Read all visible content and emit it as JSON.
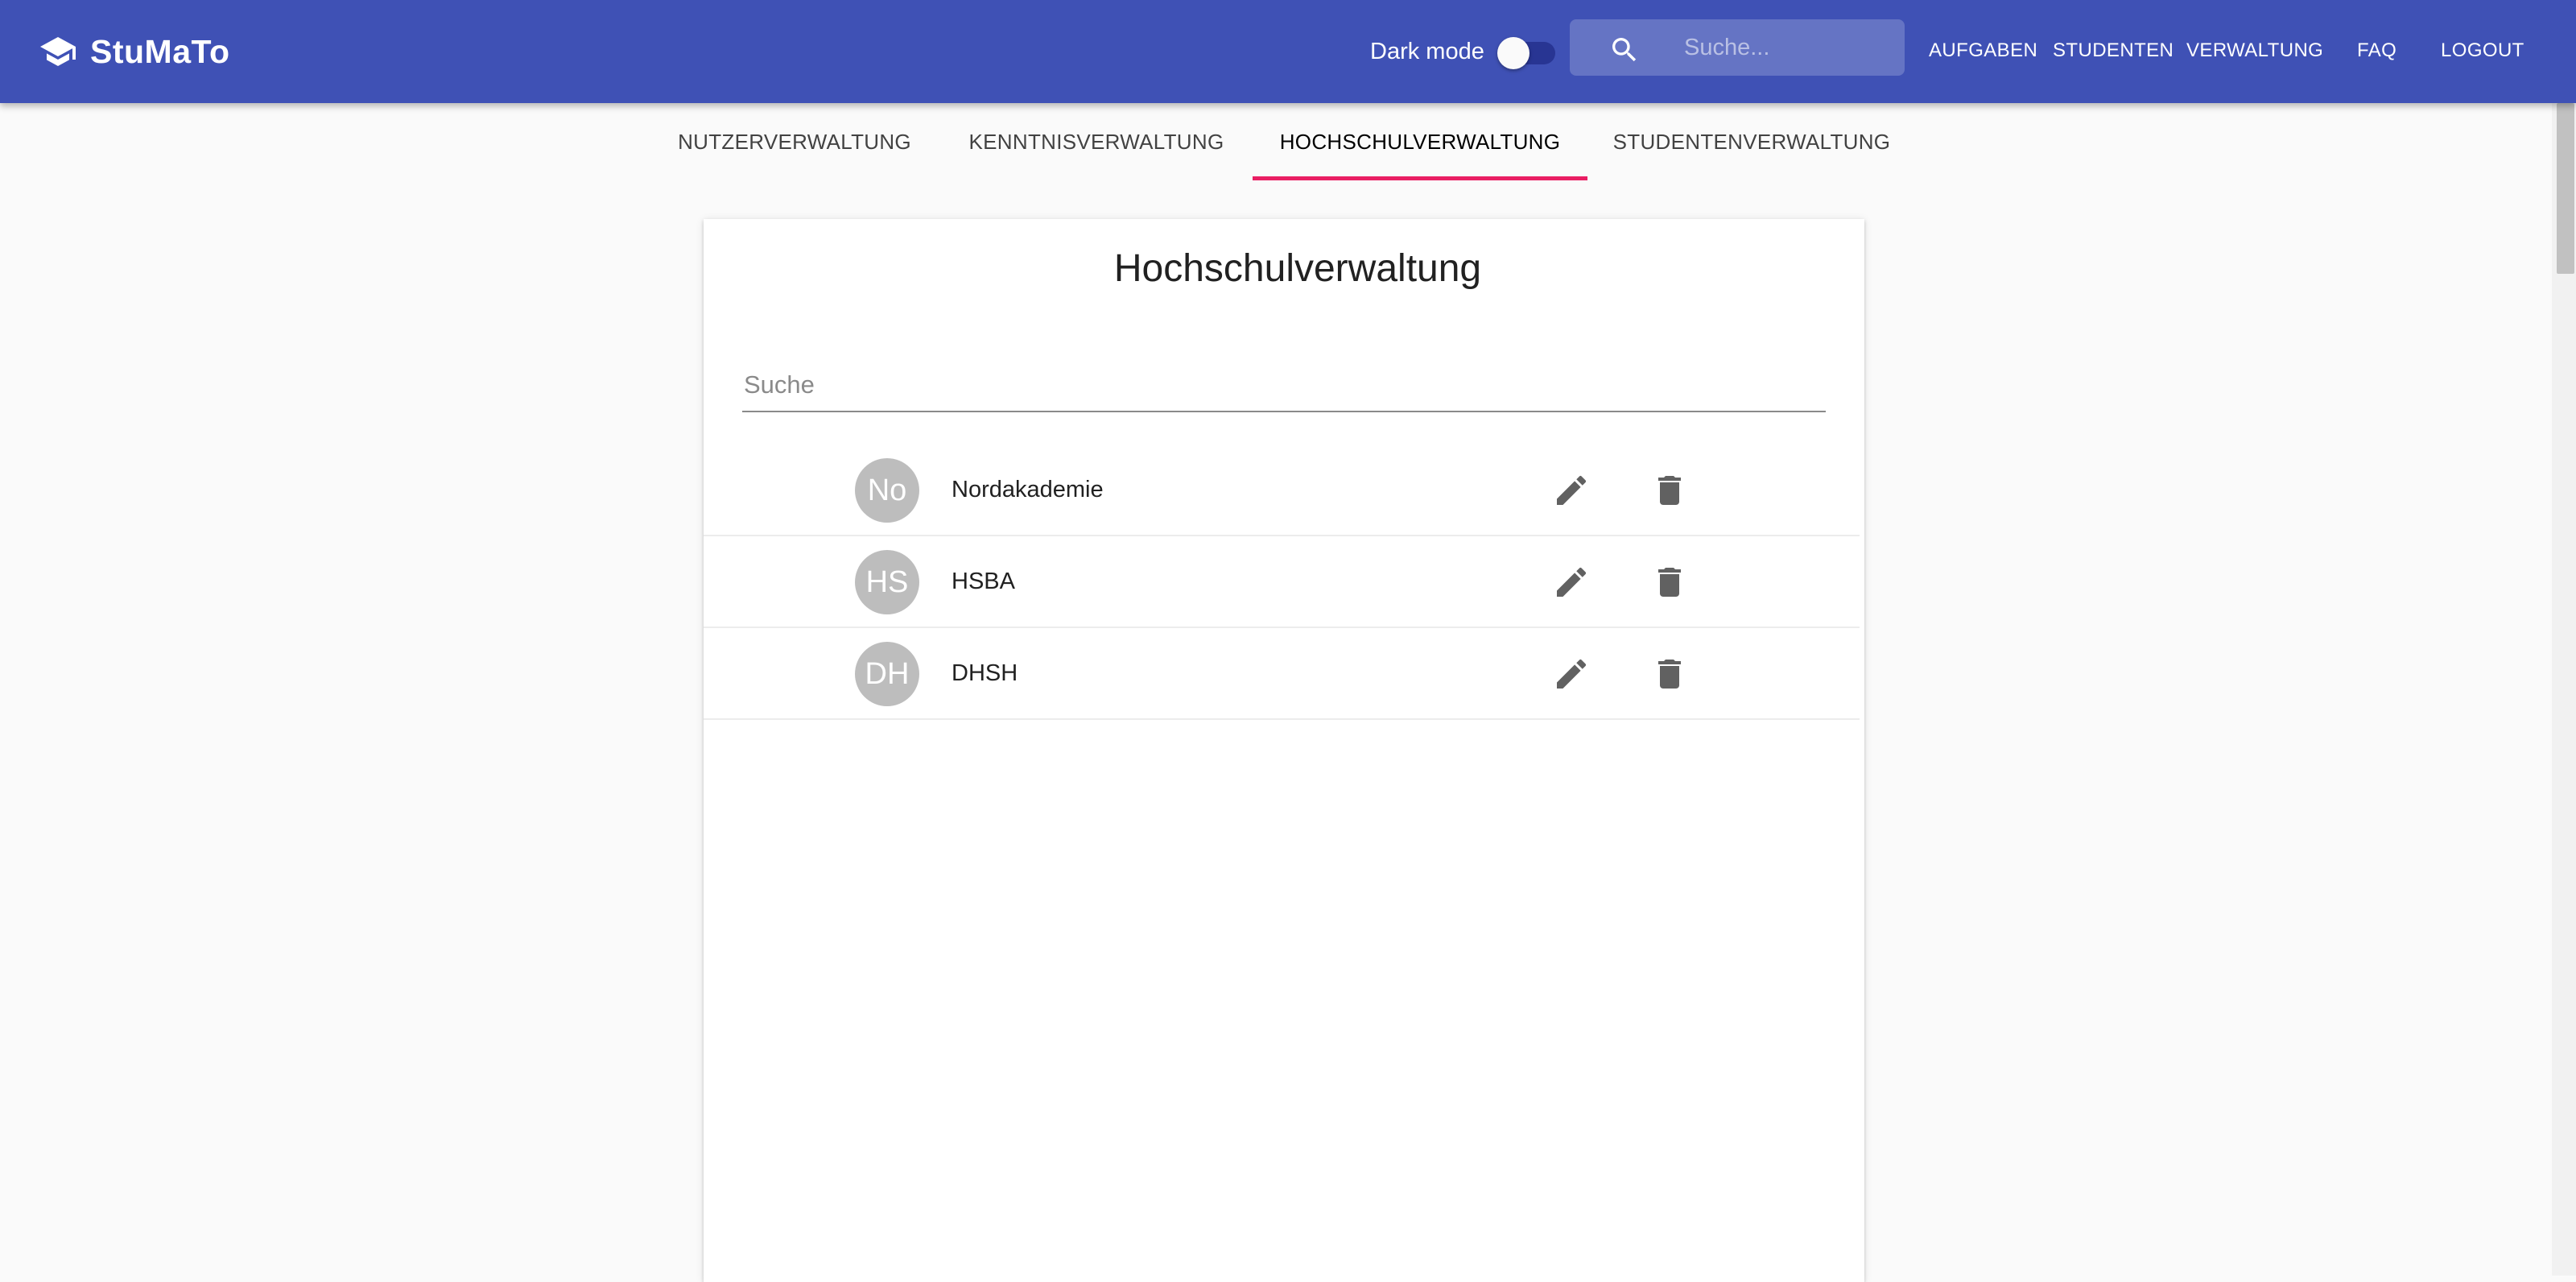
{
  "app": {
    "name": "StuMaTo",
    "logo_icon": "school-cap-icon"
  },
  "header": {
    "dark_mode_label": "Dark mode",
    "dark_mode_enabled": false,
    "search_placeholder": "Suche...",
    "nav": [
      {
        "label": "AUFGABEN"
      },
      {
        "label": "STUDENTEN"
      },
      {
        "label": "VERWALTUNG"
      },
      {
        "label": "FAQ"
      },
      {
        "label": "LOGOUT"
      }
    ]
  },
  "tabs": [
    {
      "label": "NUTZERVERWALTUNG",
      "active": false
    },
    {
      "label": "KENNTNISVERWALTUNG",
      "active": false
    },
    {
      "label": "HOCHSCHULVERWALTUNG",
      "active": true
    },
    {
      "label": "STUDENTENVERWALTUNG",
      "active": false
    }
  ],
  "colors": {
    "primary": "#3f51b5",
    "tab_indicator": "#e91e63",
    "avatar_bg": "#bdbdbd",
    "icon": "#616161"
  },
  "main": {
    "title": "Hochschulverwaltung",
    "filter_placeholder": "Suche",
    "items": [
      {
        "initials": "No",
        "name": "Nordakademie",
        "actions": [
          "edit-icon",
          "delete-icon"
        ]
      },
      {
        "initials": "HS",
        "name": "HSBA",
        "actions": [
          "edit-icon",
          "delete-icon"
        ]
      },
      {
        "initials": "DH",
        "name": "DHSH",
        "actions": [
          "edit-icon",
          "delete-icon"
        ]
      }
    ]
  }
}
